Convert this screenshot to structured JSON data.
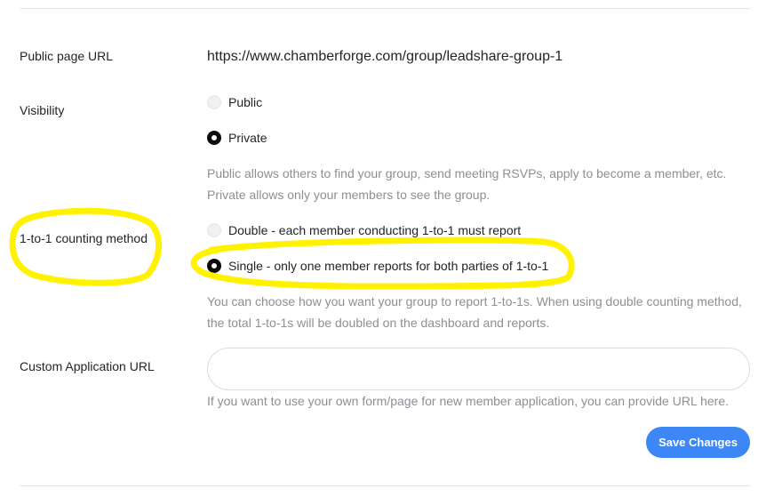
{
  "public_url": {
    "label": "Public page URL",
    "value": "https://www.chamberforge.com/group/leadshare-group-1"
  },
  "visibility": {
    "label": "Visibility",
    "options": [
      "Public",
      "Private"
    ],
    "selected": "Private",
    "help_lines": [
      "Public allows others to find your group, send meeting RSVPs, apply to become a member, etc.",
      "Private allows only your members to see the group."
    ]
  },
  "counting_method": {
    "label": "1-to-1 counting method",
    "options": [
      "Double - each member conducting 1-to-1 must report",
      "Single - only one member reports for both parties of 1-to-1"
    ],
    "selected": "Single - only one member reports for both parties of 1-to-1",
    "help_lines": [
      "You can choose how you want your group to report 1-to-1s. When using double counting method,",
      "the total 1-to-1s will be doubled on the dashboard and reports."
    ]
  },
  "custom_application": {
    "label": "Custom Application URL",
    "value": "",
    "placeholder": "",
    "help": "If you want to use your own form/page for new member application, you can provide URL here."
  },
  "actions": {
    "save_label": "Save Changes"
  },
  "colors": {
    "accent": "#3d86f5",
    "highlight": "#fff200"
  }
}
